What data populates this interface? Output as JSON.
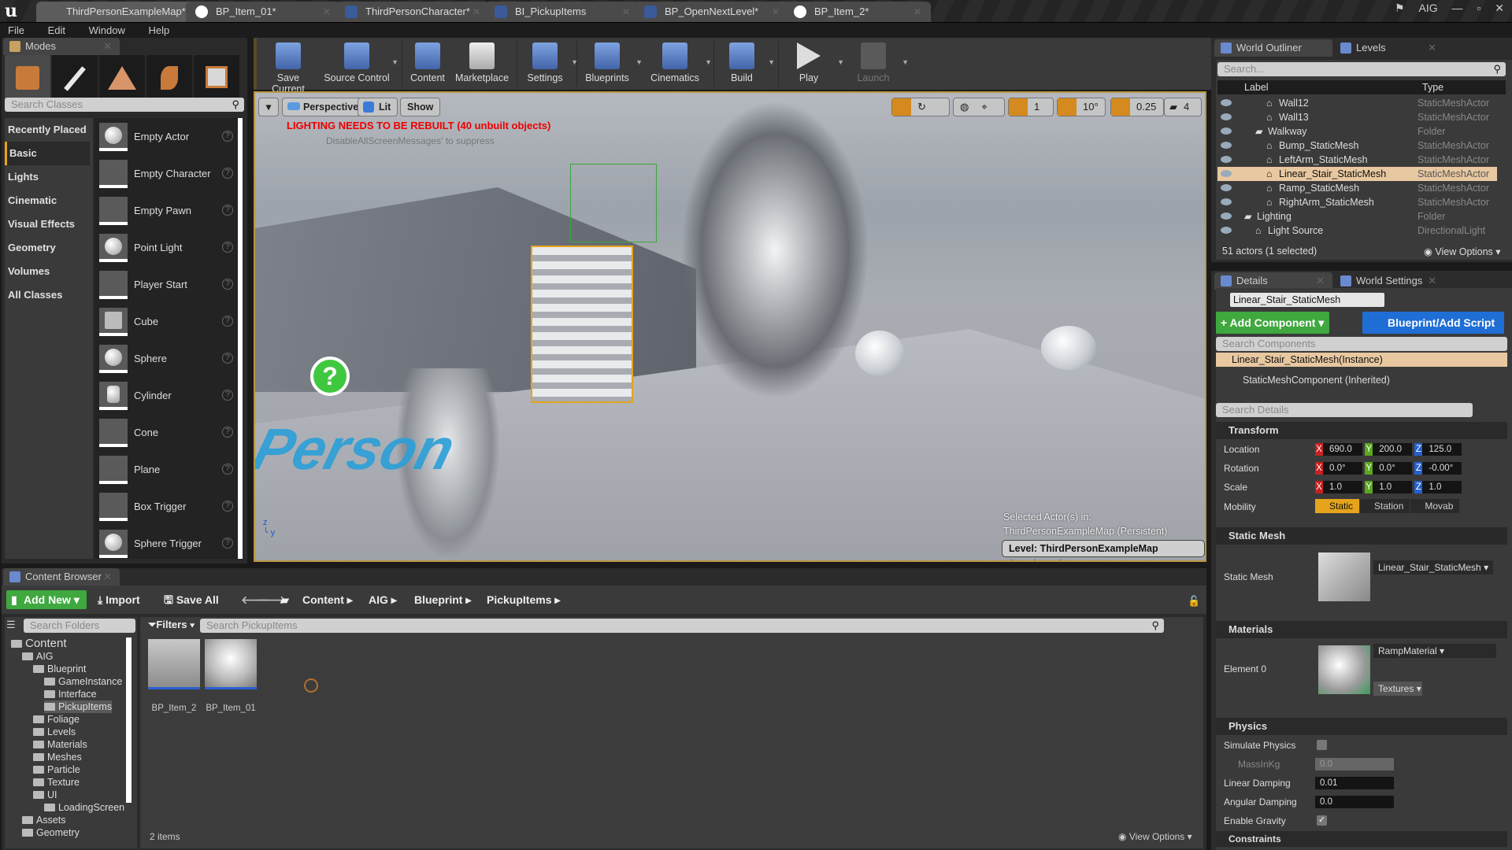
{
  "title_bar": {
    "tabs": [
      {
        "label": "ThirdPersonExampleMap*",
        "active": true
      },
      {
        "label": "BP_Item_01*"
      },
      {
        "label": "ThirdPersonCharacter*"
      },
      {
        "label": "BI_PickupItems"
      },
      {
        "label": "BP_OpenNextLevel*"
      },
      {
        "label": "BP_Item_2*"
      }
    ],
    "project": "AIG"
  },
  "menu": [
    "File",
    "Edit",
    "Window",
    "Help"
  ],
  "modes": {
    "tab_label": "Modes",
    "search_placeholder": "Search Classes",
    "categories": [
      "Recently Placed",
      "Basic",
      "Lights",
      "Cinematic",
      "Visual Effects",
      "Geometry",
      "Volumes",
      "All Classes"
    ],
    "active_category": "Basic",
    "items": [
      "Empty Actor",
      "Empty Character",
      "Empty Pawn",
      "Point Light",
      "Player Start",
      "Cube",
      "Sphere",
      "Cylinder",
      "Cone",
      "Plane",
      "Box Trigger",
      "Sphere Trigger"
    ]
  },
  "toolbar": {
    "buttons": [
      {
        "label": "Save Current"
      },
      {
        "label": "Source Control"
      },
      {
        "label": "Content"
      },
      {
        "label": "Marketplace"
      },
      {
        "label": "Settings"
      },
      {
        "label": "Blueprints"
      },
      {
        "label": "Cinematics"
      },
      {
        "label": "Build"
      },
      {
        "label": "Play"
      },
      {
        "label": "Launch"
      }
    ]
  },
  "viewport": {
    "view_mode": "Perspective",
    "lit": "Lit",
    "show": "Show",
    "warning": "LIGHTING NEEDS TO BE REBUILT (40 unbuilt objects)",
    "suppress_hint": "DisableAllScreenMessages' to suppress",
    "grid_snap": "1",
    "rotation_snap": "10°",
    "scale_snap": "0.25",
    "camera_speed": "4",
    "selected_actor_line1": "Selected Actor(s) in:",
    "selected_actor_line2": "ThirdPersonExampleMap (Persistent)",
    "level_label": "Level:  ThirdPersonExampleMap (Persistent)",
    "floor_text": "Person"
  },
  "outliner": {
    "tab_label": "World Outliner",
    "levels_tab": "Levels",
    "search_placeholder": "Search...",
    "col_label": "Label",
    "col_type": "Type",
    "rows": [
      {
        "label": "Wall12",
        "type": "StaticMeshActor",
        "indent": 3
      },
      {
        "label": "Wall13",
        "type": "StaticMeshActor",
        "indent": 3
      },
      {
        "label": "Walkway",
        "type": "Folder",
        "indent": 2
      },
      {
        "label": "Bump_StaticMesh",
        "type": "StaticMeshActor",
        "indent": 3
      },
      {
        "label": "LeftArm_StaticMesh",
        "type": "StaticMeshActor",
        "indent": 3
      },
      {
        "label": "Linear_Stair_StaticMesh",
        "type": "StaticMeshActor",
        "indent": 3,
        "selected": true
      },
      {
        "label": "Ramp_StaticMesh",
        "type": "StaticMeshActor",
        "indent": 3
      },
      {
        "label": "RightArm_StaticMesh",
        "type": "StaticMeshActor",
        "indent": 3
      },
      {
        "label": "Lighting",
        "type": "Folder",
        "indent": 1
      },
      {
        "label": "Light Source",
        "type": "DirectionalLight",
        "indent": 2
      }
    ],
    "footer": "51 actors (1 selected)",
    "view_options": "View Options"
  },
  "details": {
    "tab_label": "Details",
    "world_settings_tab": "World Settings",
    "actor_name": "Linear_Stair_StaticMesh",
    "add_component": "+ Add Component",
    "blueprint_script": "Blueprint/Add Script",
    "component_search_placeholder": "Search Components",
    "component_instance": "Linear_Stair_StaticMesh(Instance)",
    "component_inherited": "StaticMeshComponent (Inherited)",
    "details_search_placeholder": "Search Details",
    "transform": {
      "section": "Transform",
      "location_label": "Location",
      "rotation_label": "Rotation",
      "scale_label": "Scale",
      "mobility_label": "Mobility",
      "location": [
        "690.0",
        "200.0",
        "125.0"
      ],
      "rotation": [
        "0.0°",
        "0.0°",
        "-0.00°"
      ],
      "scale": [
        "1.0",
        "1.0",
        "1.0"
      ],
      "mobility_options": [
        "Static",
        "Station",
        "Movab"
      ],
      "mobility_selected": "Static"
    },
    "static_mesh": {
      "section": "Static Mesh",
      "label": "Static Mesh",
      "value": "Linear_Stair_StaticMesh"
    },
    "materials": {
      "section": "Materials",
      "element_label": "Element 0",
      "value": "RampMaterial",
      "textures": "Textures"
    },
    "physics": {
      "section": "Physics",
      "simulate_physics": "Simulate Physics",
      "mass": "MassInKg",
      "mass_value": "0.0",
      "linear_damping": "Linear Damping",
      "linear_damping_value": "0.01",
      "angular_damping": "Angular Damping",
      "angular_damping_value": "0.0",
      "enable_gravity": "Enable Gravity",
      "simulate_checked": false,
      "gravity_checked": true
    },
    "constraints_section": "Constraints"
  },
  "content_browser": {
    "tab_label": "Content Browser",
    "add_new": "Add New",
    "import": "Import",
    "save_all": "Save All",
    "breadcrumb": [
      "Content",
      "AIG",
      "Blueprint",
      "PickupItems"
    ],
    "folder_search_placeholder": "Search Folders",
    "filters": "Filters",
    "asset_search_placeholder": "Search PickupItems",
    "folders": [
      {
        "label": "Content",
        "indent": 0
      },
      {
        "label": "AIG",
        "indent": 1
      },
      {
        "label": "Blueprint",
        "indent": 2
      },
      {
        "label": "GameInstance",
        "indent": 3
      },
      {
        "label": "Interface",
        "indent": 3
      },
      {
        "label": "PickupItems",
        "indent": 3,
        "selected": true
      },
      {
        "label": "Foliage",
        "indent": 2
      },
      {
        "label": "Levels",
        "indent": 2
      },
      {
        "label": "Materials",
        "indent": 2
      },
      {
        "label": "Meshes",
        "indent": 2
      },
      {
        "label": "Particle",
        "indent": 2
      },
      {
        "label": "Texture",
        "indent": 2
      },
      {
        "label": "UI",
        "indent": 2
      },
      {
        "label": "LoadingScreen",
        "indent": 3
      },
      {
        "label": "Assets",
        "indent": 1
      },
      {
        "label": "Geometry",
        "indent": 1
      }
    ],
    "assets": [
      "BP_Item_2",
      "BP_Item_01"
    ],
    "item_count": "2 items",
    "view_options": "View Options"
  }
}
